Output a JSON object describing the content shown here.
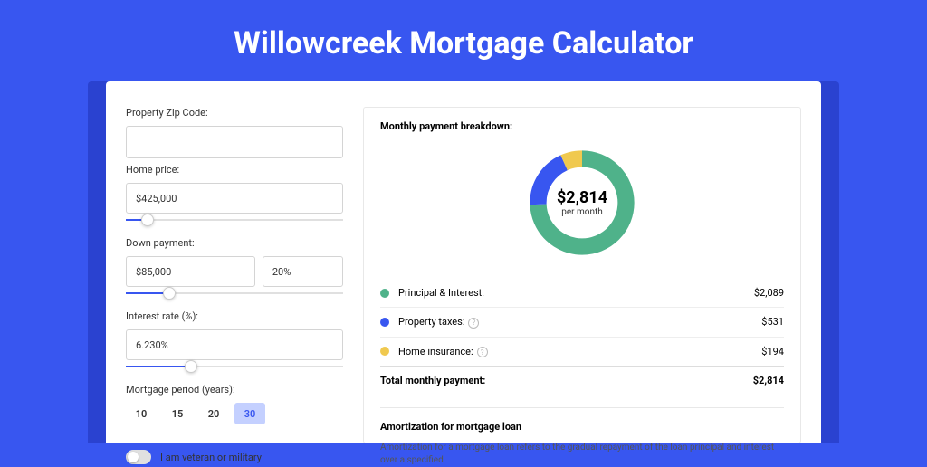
{
  "title": "Willowcreek Mortgage Calculator",
  "form": {
    "zip_label": "Property Zip Code:",
    "zip_value": "",
    "price_label": "Home price:",
    "price_value": "$425,000",
    "price_slider_pct": 10,
    "dp_label": "Down payment:",
    "dp_amount": "$85,000",
    "dp_pct": "20%",
    "dp_slider_pct": 20,
    "rate_label": "Interest rate (%):",
    "rate_value": "6.230%",
    "rate_slider_pct": 30,
    "period_label": "Mortgage period (years):",
    "periods": [
      "10",
      "15",
      "20",
      "30"
    ],
    "period_active": "30",
    "veteran_label": "I am veteran or military"
  },
  "breakdown": {
    "title": "Monthly payment breakdown:",
    "center_amount": "$2,814",
    "center_sub": "per month",
    "items": [
      {
        "label": "Principal & Interest:",
        "value": "$2,089",
        "color": "#4fb28a",
        "has_info": false
      },
      {
        "label": "Property taxes:",
        "value": "$531",
        "color": "#3856f0",
        "has_info": true
      },
      {
        "label": "Home insurance:",
        "value": "$194",
        "color": "#f0c94f",
        "has_info": true
      }
    ],
    "total_label": "Total monthly payment:",
    "total_value": "$2,814"
  },
  "amort": {
    "title": "Amortization for mortgage loan",
    "text": "Amortization for a mortgage loan refers to the gradual repayment of the loan principal and interest over a specified"
  },
  "chart_data": {
    "type": "pie",
    "title": "Monthly payment breakdown",
    "series": [
      {
        "name": "Principal & Interest",
        "value": 2089,
        "color": "#4fb28a"
      },
      {
        "name": "Property taxes",
        "value": 531,
        "color": "#3856f0"
      },
      {
        "name": "Home insurance",
        "value": 194,
        "color": "#f0c94f"
      }
    ],
    "total": 2814,
    "center_label": "$2,814 per month"
  }
}
